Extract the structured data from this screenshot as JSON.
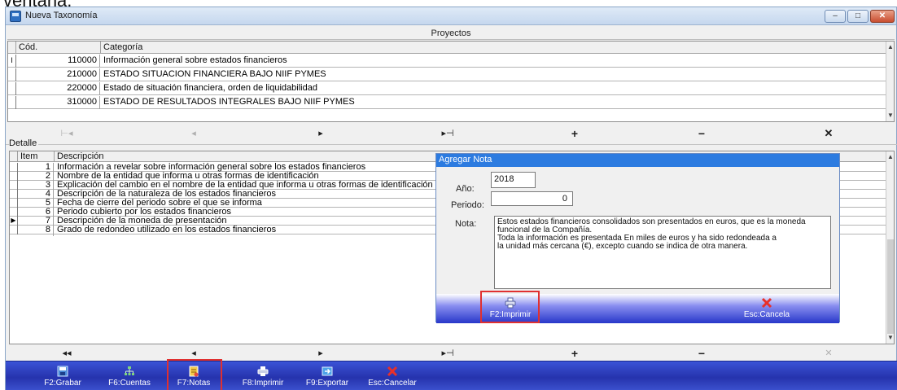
{
  "caption_fragment": "ventana.",
  "window": {
    "title": "Nueva Taxonomía",
    "controls": {
      "minimize": "–",
      "maximize": "□",
      "close": "✕"
    }
  },
  "projects": {
    "section_title": "Proyectos",
    "columns": [
      "Cód.",
      "Categoría"
    ],
    "current_row_marker": "I",
    "rows": [
      {
        "code": "110000",
        "category": "Información general sobre estados financieros"
      },
      {
        "code": "210000",
        "category": "ESTADO SITUACION FINANCIERA BAJO NIIF PYMES"
      },
      {
        "code": "220000",
        "category": "Estado de situación financiera, orden de liquidabilidad"
      },
      {
        "code": "310000",
        "category": "ESTADO DE RESULTADOS INTEGRALES BAJO NIIF PYMES"
      }
    ],
    "nav": [
      "⊢◂",
      "◂",
      "▸",
      "▸⊣",
      "+",
      "−",
      "✕"
    ]
  },
  "detail": {
    "group_label": "Detalle",
    "columns": [
      "Item",
      "Descripción"
    ],
    "current_row_marker": "▶",
    "rows": [
      {
        "item": "1",
        "description": "Información a revelar sobre información general sobre los estados financieros"
      },
      {
        "item": "2",
        "description": "Nombre de la entidad que informa u otras formas de identificación"
      },
      {
        "item": "3",
        "description": "Explicación del cambio en el nombre de la entidad que informa u otras formas de identificación desde el fin..."
      },
      {
        "item": "4",
        "description": "Descripción de la naturaleza de los estados financieros"
      },
      {
        "item": "5",
        "description": "Fecha de cierre del periodo sobre el que se informa"
      },
      {
        "item": "6",
        "description": "Periodo cubierto por los estados financieros"
      },
      {
        "item": "7",
        "description": "Descripción de la moneda de presentación"
      },
      {
        "item": "8",
        "description": "Grado de redondeo utilizado en los estados financieros"
      }
    ],
    "nav": [
      "◂◂",
      "◂",
      "▸",
      "▸⊣",
      "+",
      "−",
      "✕"
    ]
  },
  "dialog": {
    "title": "Agregar Nota",
    "year_label": "Año:",
    "year_value": "2018",
    "period_label": "Periodo:",
    "period_value": "0",
    "note_label": "Nota:",
    "note_lines": [
      "Estos estados financieros consolidados son presentados en euros, que es la moneda",
      "funcional de la Compañía.",
      "Toda la información es presentada En miles de euros y ha sido redondeada a",
      "la unidad más cercana (€), excepto cuando se indica de otra manera."
    ],
    "print_button": "F2:Imprimir",
    "cancel_button": "Esc:Cancela"
  },
  "toolbar": {
    "buttons": [
      {
        "label": "F2:Grabar",
        "icon": "floppy-icon"
      },
      {
        "label": "F6:Cuentas",
        "icon": "accounts-icon"
      },
      {
        "label": "F7:Notas",
        "icon": "notes-icon"
      },
      {
        "label": "F8:Imprimir",
        "icon": "printer-icon"
      },
      {
        "label": "F9:Exportar",
        "icon": "export-icon"
      },
      {
        "label": "Esc:Cancelar",
        "icon": "cancel-icon"
      }
    ]
  },
  "colors": {
    "toolbar_blue": "#2a3bbf",
    "dialog_title_blue": "#2c7be0",
    "highlight_red": "#e03030",
    "cancel_red": "#e8302a"
  }
}
